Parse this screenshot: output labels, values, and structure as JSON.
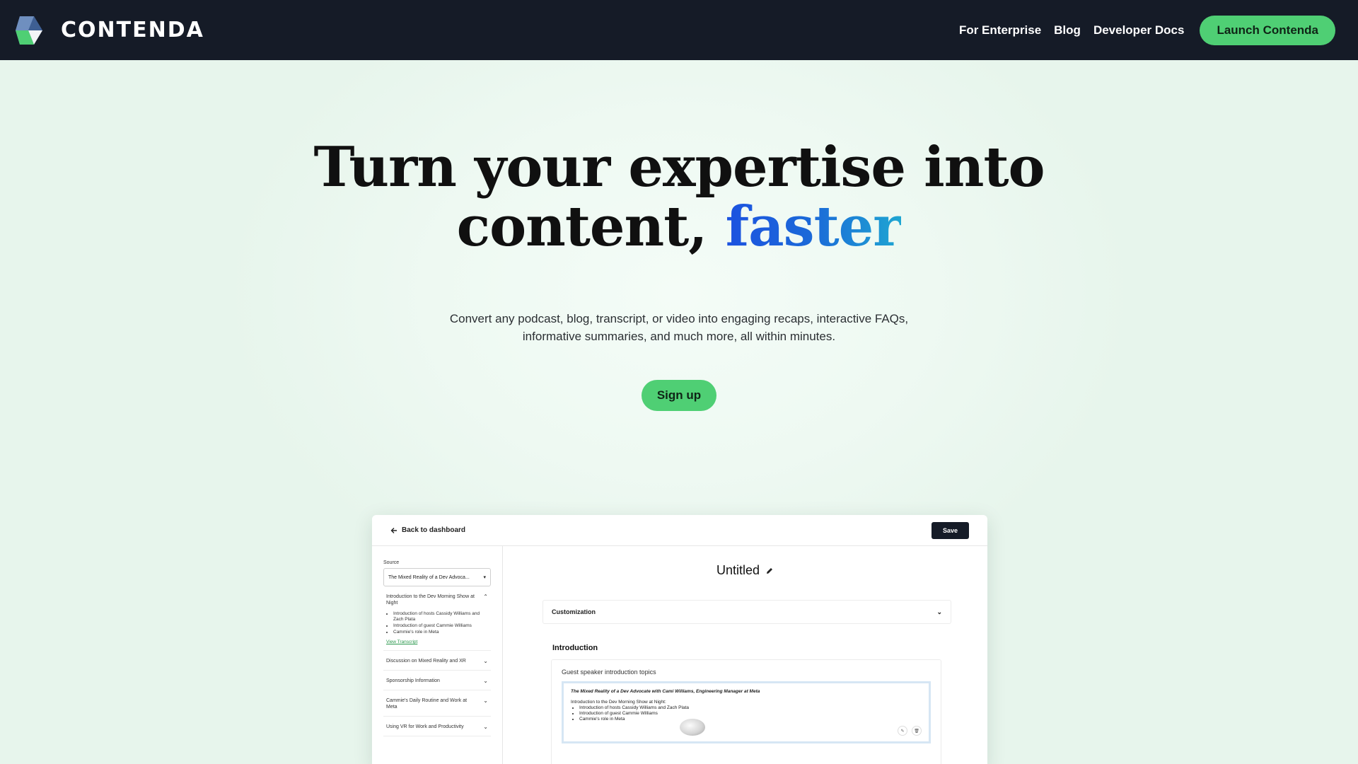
{
  "header": {
    "brand_name": "CONTENDA",
    "nav": [
      {
        "label": "For Enterprise"
      },
      {
        "label": "Blog"
      },
      {
        "label": "Developer Docs"
      }
    ],
    "cta_label": "Launch Contenda",
    "colors": {
      "bar": "#151b27",
      "cta": "#4fcf74"
    }
  },
  "hero": {
    "title_line1": "Turn your expertise into",
    "title_line2_prefix": "content,",
    "title_accent": "faster",
    "subtitle_line1": "Convert any podcast, blog, transcript, or video into engaging recaps, interactive FAQs,",
    "subtitle_line2": "informative summaries, and much more, all within minutes.",
    "signup_label": "Sign up"
  },
  "preview": {
    "back_label": "Back to dashboard",
    "save_label": "Save",
    "source_label": "Source",
    "source_value": "The Mixed Reality of a Dev Advoca...",
    "sections": [
      {
        "title": "Introduction to the Dev Morning Show at Night",
        "expanded": true,
        "items": [
          "Introduction of hosts Cassidy Williams and Zach Plata",
          "Introduction of guest Cammie Williams",
          "Cammie's role in Meta"
        ],
        "link": "View Transcript"
      },
      {
        "title": "Discussion on Mixed Reality and XR",
        "expanded": false
      },
      {
        "title": "Sponsorship Information",
        "expanded": false
      },
      {
        "title": "Cammie's Daily Routine and Work at Meta",
        "expanded": false
      },
      {
        "title": "Using VR for Work and Productivity",
        "expanded": false
      }
    ],
    "doc_title": "Untitled",
    "customization_label": "Customization",
    "intro_heading": "Introduction",
    "card_label": "Guest speaker introduction topics",
    "quote_title": "The Mixed Reality of a Dev Advocate with Cami Williams, Engineering Manager at Meta",
    "quote_line": "Introduction to the Dev Morning Show at Night:",
    "quote_items": [
      "Introduction of hosts Cassidy Williams and Zach Plata",
      "Introduction of guest Cammie Williams",
      "Cammie's role in Meta"
    ]
  }
}
